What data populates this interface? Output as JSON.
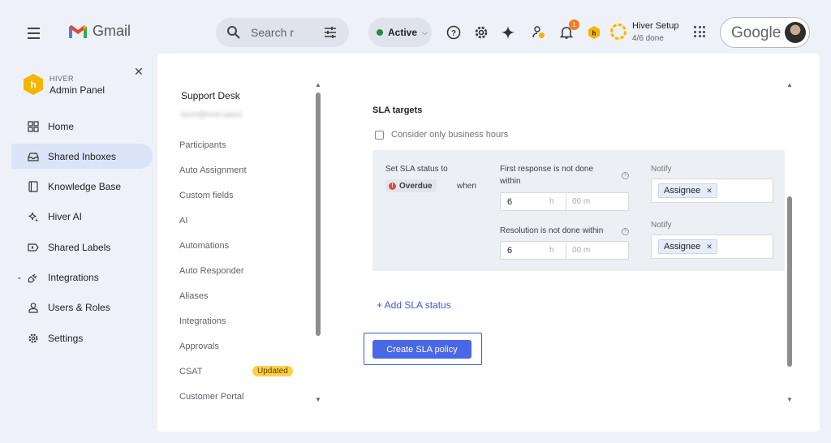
{
  "gmail": {
    "app_name": "Gmail"
  },
  "search": {
    "placeholder": "Search r"
  },
  "status": {
    "label": "Active"
  },
  "notifications": {
    "count": "1"
  },
  "hiver_setup": {
    "title": "Hiver Setup",
    "progress": "4/6 done"
  },
  "account": {
    "brand": "Google"
  },
  "sidebar": {
    "brand_sub": "HIVER",
    "brand_title": "Admin Panel",
    "items": [
      {
        "label": "Home",
        "icon": "grid-icon"
      },
      {
        "label": "Shared Inboxes",
        "icon": "inbox-icon",
        "active": true
      },
      {
        "label": "Knowledge Base",
        "icon": "book-icon"
      },
      {
        "label": "Hiver AI",
        "icon": "sparkle-icon"
      },
      {
        "label": "Shared Labels",
        "icon": "label-icon"
      },
      {
        "label": "Integrations",
        "icon": "plug-icon"
      },
      {
        "label": "Users & Roles",
        "icon": "user-icon"
      },
      {
        "label": "Settings",
        "icon": "gear-icon"
      }
    ]
  },
  "subnav": {
    "title": "Support Desk",
    "email": "kevin@hiver.space",
    "items": [
      {
        "label": "Participants"
      },
      {
        "label": "Auto Assignment"
      },
      {
        "label": "Custom fields"
      },
      {
        "label": "AI"
      },
      {
        "label": "Automations"
      },
      {
        "label": "Auto Responder"
      },
      {
        "label": "Aliases"
      },
      {
        "label": "Integrations"
      },
      {
        "label": "Approvals"
      },
      {
        "label": "CSAT",
        "badge": "Updated"
      },
      {
        "label": "Customer Portal"
      }
    ]
  },
  "sla": {
    "heading": "SLA targets",
    "business_hours_label": "Consider only business hours",
    "set_status_label": "Set SLA status to",
    "status_value": "Overdue",
    "when_label": "when",
    "first_response_label": "First response is not done within",
    "resolution_label": "Resolution is not done within",
    "first_response_hours": "6",
    "resolution_hours": "6",
    "hours_unit": "h",
    "minutes_placeholder": "00 m",
    "notify_label": "Notify",
    "notify_chip": "Assignee",
    "add_status": "+ Add SLA status",
    "create_button": "Create SLA policy"
  }
}
